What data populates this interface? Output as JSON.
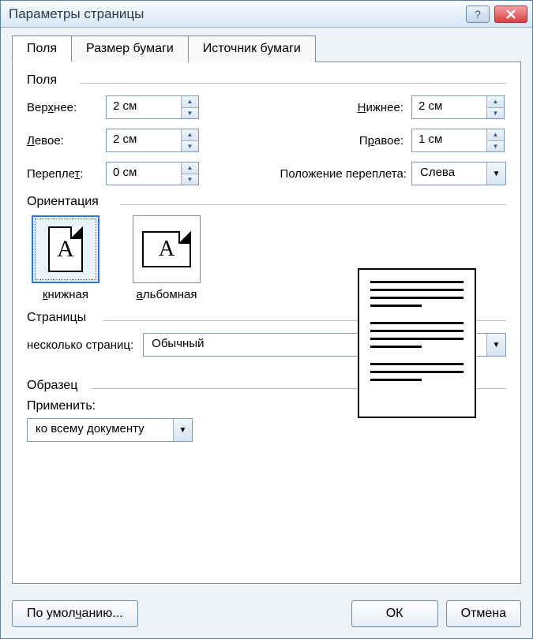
{
  "window": {
    "title": "Параметры страницы"
  },
  "tabs": {
    "fields": "Поля",
    "paper_size": "Размер бумаги",
    "paper_source": "Источник бумаги"
  },
  "groups": {
    "margins": "Поля",
    "orientation": "Ориентация",
    "pages": "Страницы",
    "sample": "Образец"
  },
  "margins": {
    "top_label_pre": "Вер",
    "top_label_u": "х",
    "top_label_post": "нее:",
    "bottom_label_u": "Н",
    "bottom_label_post": "ижнее:",
    "left_label_u": "Л",
    "left_label_post": "евое:",
    "right_label_pre": "П",
    "right_label_u": "р",
    "right_label_post": "авое:",
    "gutter_label_pre": "Перепле",
    "gutter_label_u": "т",
    "gutter_label_post": ":",
    "gutter_pos_label": "Положение переплета:",
    "top": "2 см",
    "bottom": "2 см",
    "left": "2 см",
    "right": "1 см",
    "gutter": "0 см",
    "gutter_position": "Слева"
  },
  "orientation": {
    "portrait_u": "к",
    "portrait_rest": "нижная",
    "landscape_u": "а",
    "landscape_rest": "льбомная",
    "glyph": "A"
  },
  "pages": {
    "label": "несколько страниц:",
    "value": "Обычный"
  },
  "sample": {
    "apply_label": "Применить:",
    "apply_value": "ко всему документу"
  },
  "buttons": {
    "default_pre": "По умол",
    "default_u": "ч",
    "default_post": "анию...",
    "ok": "ОК",
    "cancel": "Отмена"
  }
}
